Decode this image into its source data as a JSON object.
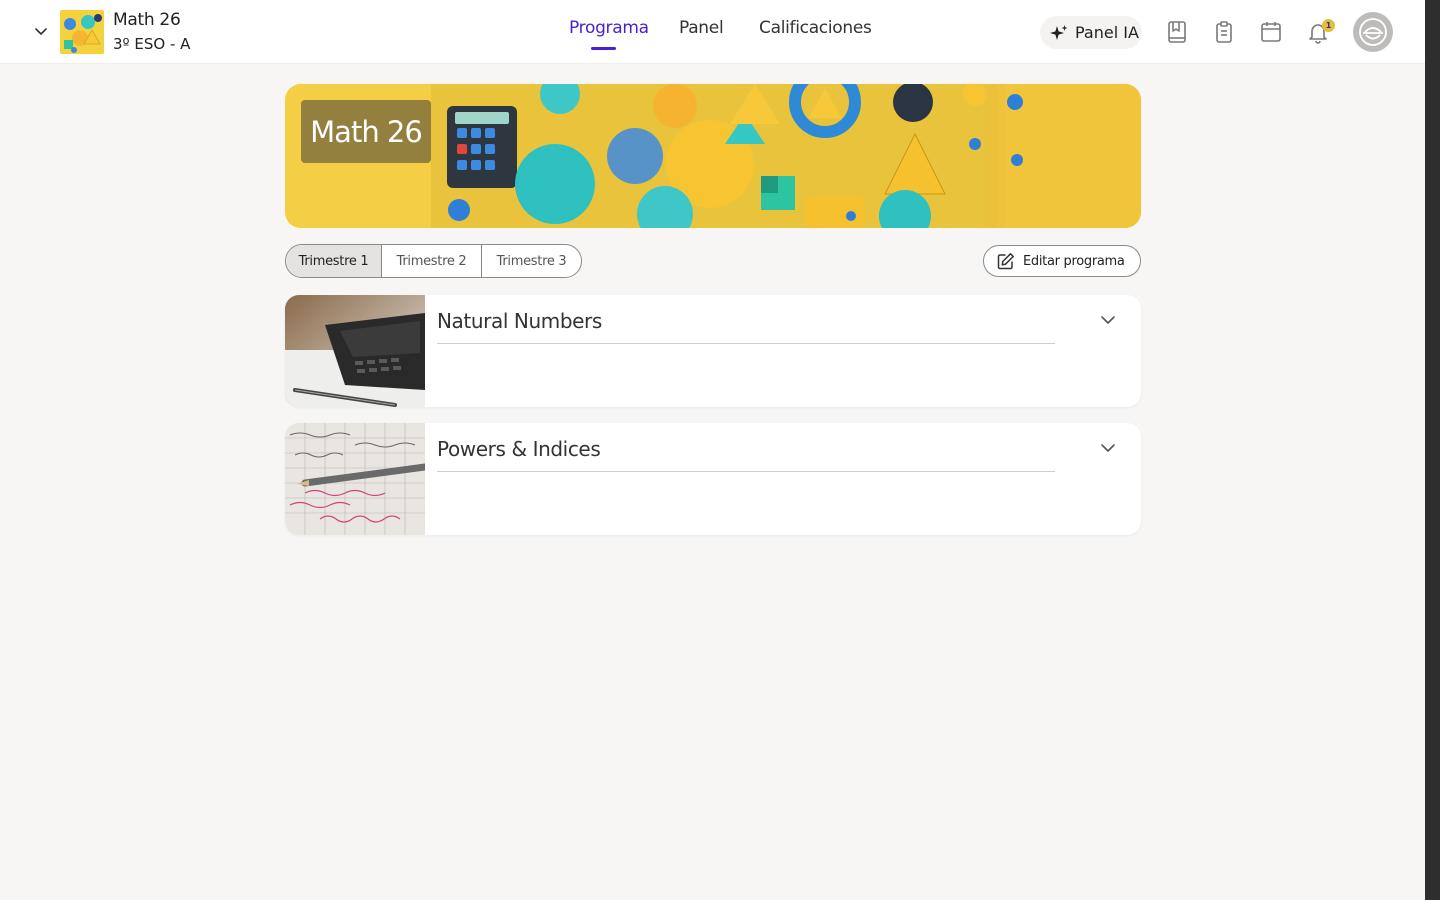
{
  "header": {
    "course_name": "Math 26",
    "course_group": "3º ESO - A",
    "nav": [
      {
        "label": "Programa",
        "active": true
      },
      {
        "label": "Panel",
        "active": false
      },
      {
        "label": "Calificaciones",
        "active": false
      }
    ],
    "ai_button_label": "Panel IA",
    "notification_count": "1",
    "icons": [
      "chevron-down-icon",
      "sparkle-icon",
      "book-icon",
      "clipboard-icon",
      "calendar-icon",
      "bell-icon",
      "avatar-icon"
    ]
  },
  "banner": {
    "title": "Math 26"
  },
  "terms": {
    "tabs": [
      "Trimestre 1",
      "Trimestre 2",
      "Trimestre 3"
    ],
    "active_index": 0
  },
  "actions": {
    "edit_label": "Editar programa"
  },
  "units": [
    {
      "title": "Natural Numbers",
      "image": "calculator-photo"
    },
    {
      "title": "Powers & Indices",
      "image": "handwritten-notes-photo"
    }
  ],
  "colors": {
    "accent": "#4b1fd0",
    "background": "#f7f6f5",
    "banner_yellow": "#f4cf45",
    "notification_badge": "#e2bf3a"
  }
}
